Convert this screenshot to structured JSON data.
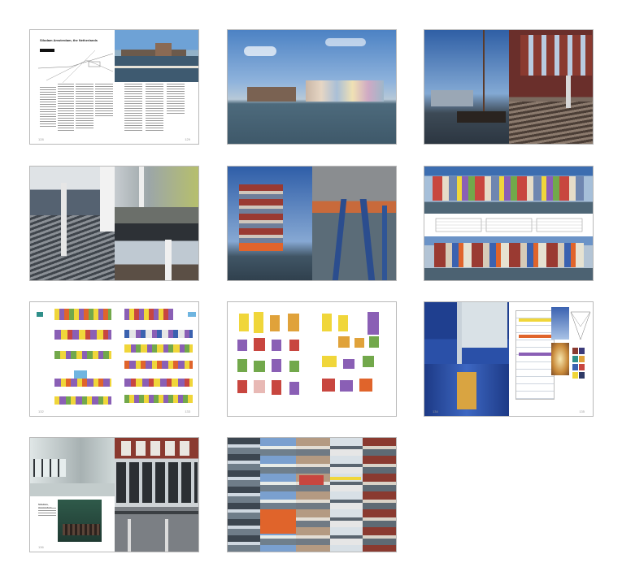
{
  "spreads": [
    {
      "id": "s1",
      "title": "Silodam Amsterdam, the Netherlands",
      "left_page": "128",
      "right_page": "129"
    },
    {
      "id": "s2"
    },
    {
      "id": "s3"
    },
    {
      "id": "s4"
    },
    {
      "id": "s5"
    },
    {
      "id": "s6"
    },
    {
      "id": "s7",
      "left_page": "132",
      "right_page": "133"
    },
    {
      "id": "s8"
    },
    {
      "id": "s9",
      "left_page": "134",
      "right_page": "135"
    },
    {
      "id": "s10",
      "left_caption": "Silodam, Amsterdam",
      "left_page": "136"
    },
    {
      "id": "s11"
    }
  ],
  "palette": {
    "sky": "#3f76b9",
    "water": "#5b6c78",
    "orange": "#e0642b",
    "yellow": "#f0d63a",
    "purple": "#8a5fb5",
    "green": "#72a84b",
    "red": "#c8463f",
    "blue": "#3b62b0",
    "teal": "#2f8f8a",
    "brick": "#8a3a30"
  }
}
